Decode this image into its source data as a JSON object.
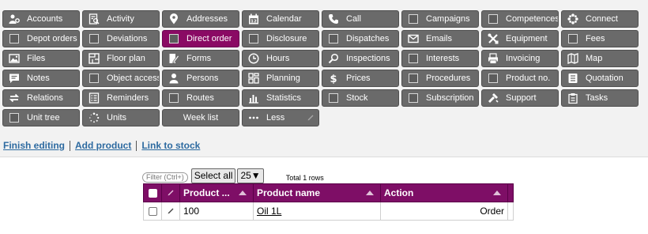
{
  "tiles": [
    {
      "label": "Accounts",
      "icon": "accounts-icon"
    },
    {
      "label": "Activity",
      "icon": "activity-icon"
    },
    {
      "label": "Addresses",
      "icon": "location-pin-icon"
    },
    {
      "label": "Calendar",
      "icon": "calendar-icon"
    },
    {
      "label": "Call",
      "icon": "phone-icon"
    },
    {
      "label": "Campaigns",
      "icon": "checkbox-icon"
    },
    {
      "label": "Competences",
      "icon": "checkbox-icon"
    },
    {
      "label": "Connect",
      "icon": "connect-icon"
    },
    {
      "label": "Depot orders",
      "icon": "checkbox-icon"
    },
    {
      "label": "Deviations",
      "icon": "checkbox-icon"
    },
    {
      "label": "Direct order",
      "icon": "checkbox-icon",
      "active": true
    },
    {
      "label": "Disclosure",
      "icon": "checkbox-icon"
    },
    {
      "label": "Dispatches",
      "icon": "checkbox-icon"
    },
    {
      "label": "Emails",
      "icon": "envelope-icon"
    },
    {
      "label": "Equipment",
      "icon": "tools-icon"
    },
    {
      "label": "Fees",
      "icon": "checkbox-icon"
    },
    {
      "label": "Files",
      "icon": "image-icon"
    },
    {
      "label": "Floor plan",
      "icon": "floor-plan-icon"
    },
    {
      "label": "Forms",
      "icon": "forms-icon"
    },
    {
      "label": "Hours",
      "icon": "clock-icon"
    },
    {
      "label": "Inspections",
      "icon": "magnifier-icon"
    },
    {
      "label": "Interests",
      "icon": "checkbox-icon"
    },
    {
      "label": "Invoicing",
      "icon": "invoice-icon"
    },
    {
      "label": "Map",
      "icon": "map-icon"
    },
    {
      "label": "Notes",
      "icon": "notes-icon"
    },
    {
      "label": "Object access",
      "icon": "checkbox-icon"
    },
    {
      "label": "Persons",
      "icon": "person-icon"
    },
    {
      "label": "Planning",
      "icon": "planning-icon"
    },
    {
      "label": "Prices",
      "icon": "dollar-icon"
    },
    {
      "label": "Procedures",
      "icon": "checkbox-icon"
    },
    {
      "label": "Product no.",
      "icon": "checkbox-icon"
    },
    {
      "label": "Quotation",
      "icon": "quotation-icon"
    },
    {
      "label": "Relations",
      "icon": "relations-icon"
    },
    {
      "label": "Reminders",
      "icon": "reminders-icon"
    },
    {
      "label": "Routes",
      "icon": "checkbox-icon"
    },
    {
      "label": "Statistics",
      "icon": "bar-chart-icon"
    },
    {
      "label": "Stock",
      "icon": "checkbox-icon"
    },
    {
      "label": "Subscription",
      "icon": "checkbox-icon"
    },
    {
      "label": "Support",
      "icon": "support-icon"
    },
    {
      "label": "Tasks",
      "icon": "clipboard-icon"
    },
    {
      "label": "Unit tree",
      "icon": "checkbox-icon"
    },
    {
      "label": "Units",
      "icon": "spinner-icon"
    },
    {
      "label": "Week list",
      "icon": "",
      "center": true
    },
    {
      "label": "Less",
      "icon": "ellipsis-icon",
      "pencil": true
    }
  ],
  "actions": {
    "finish_editing": "Finish editing",
    "add_product": "Add product",
    "link_to_stock": "Link to stock"
  },
  "toolbar": {
    "filter": "Filter (Ctrl+)",
    "select_all": "Select all",
    "page_size": "25▼",
    "total": "Total 1 rows"
  },
  "table": {
    "columns": [
      "Product ...",
      "Product name",
      "Action"
    ],
    "rows": [
      {
        "product_no": "100",
        "product_name": "Oil 1L",
        "action": "Order"
      }
    ]
  },
  "colors": {
    "tile": "#6a6a6a",
    "tile_active": "#8a0a64",
    "header": "#7e0e66",
    "link": "#2d6aa0"
  }
}
